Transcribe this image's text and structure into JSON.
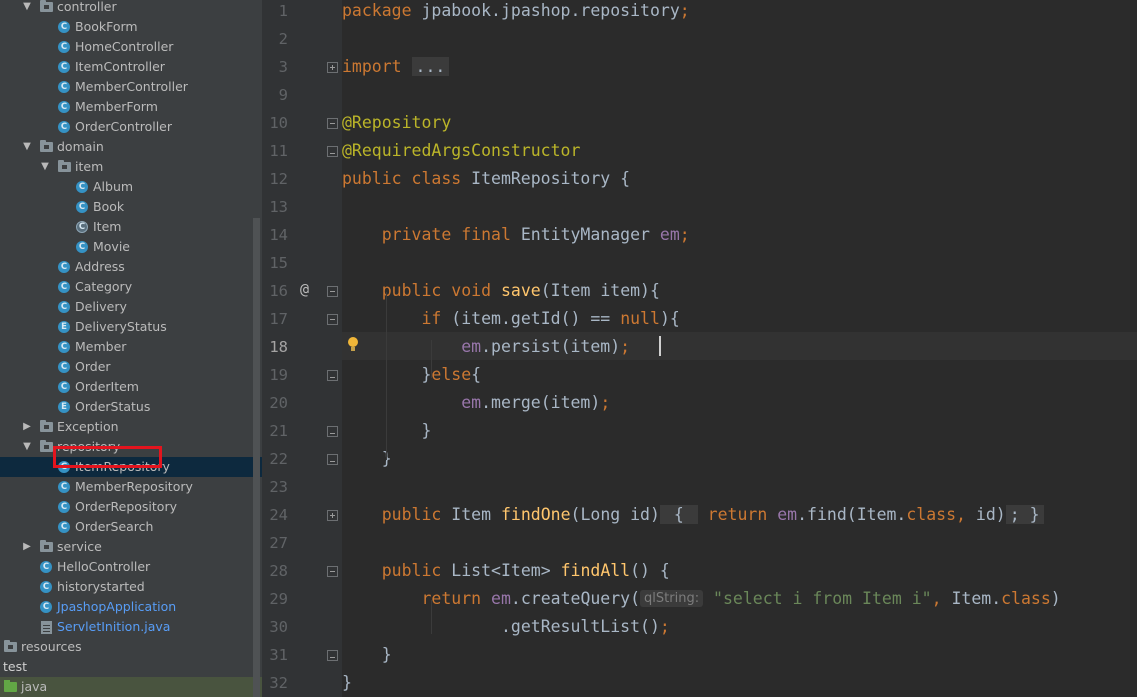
{
  "tree": [
    {
      "label": "controller",
      "kind": "folder",
      "indent": 2,
      "expanded": true
    },
    {
      "label": "BookForm",
      "kind": "class",
      "indent": 3
    },
    {
      "label": "HomeController",
      "kind": "class",
      "indent": 3
    },
    {
      "label": "ItemController",
      "kind": "class",
      "indent": 3
    },
    {
      "label": "MemberController",
      "kind": "class",
      "indent": 3
    },
    {
      "label": "MemberForm",
      "kind": "class",
      "indent": 3
    },
    {
      "label": "OrderController",
      "kind": "class",
      "indent": 3
    },
    {
      "label": "domain",
      "kind": "folder",
      "indent": 2,
      "expanded": true
    },
    {
      "label": "item",
      "kind": "folder",
      "indent": 3,
      "expanded": true
    },
    {
      "label": "Album",
      "kind": "class",
      "indent": 4
    },
    {
      "label": "Book",
      "kind": "class",
      "indent": 4
    },
    {
      "label": "Item",
      "kind": "abstract",
      "indent": 4
    },
    {
      "label": "Movie",
      "kind": "class",
      "indent": 4
    },
    {
      "label": "Address",
      "kind": "class",
      "indent": 3
    },
    {
      "label": "Category",
      "kind": "class",
      "indent": 3
    },
    {
      "label": "Delivery",
      "kind": "class",
      "indent": 3
    },
    {
      "label": "DeliveryStatus",
      "kind": "enum",
      "indent": 3
    },
    {
      "label": "Member",
      "kind": "class",
      "indent": 3
    },
    {
      "label": "Order",
      "kind": "class",
      "indent": 3
    },
    {
      "label": "OrderItem",
      "kind": "class",
      "indent": 3
    },
    {
      "label": "OrderStatus",
      "kind": "enum",
      "indent": 3
    },
    {
      "label": "Exception",
      "kind": "folder",
      "indent": 2,
      "expanded": false
    },
    {
      "label": "repository",
      "kind": "folder",
      "indent": 2,
      "expanded": true
    },
    {
      "label": "ItemRepository",
      "kind": "class",
      "indent": 3,
      "selected": true
    },
    {
      "label": "MemberRepository",
      "kind": "class",
      "indent": 3
    },
    {
      "label": "OrderRepository",
      "kind": "class",
      "indent": 3
    },
    {
      "label": "OrderSearch",
      "kind": "class",
      "indent": 3
    },
    {
      "label": "service",
      "kind": "folder",
      "indent": 2,
      "expanded": false
    },
    {
      "label": "HelloController",
      "kind": "class",
      "indent": 2
    },
    {
      "label": "historystarted",
      "kind": "class",
      "indent": 2
    },
    {
      "label": "JpashopApplication",
      "kind": "class-blue",
      "indent": 2
    },
    {
      "label": "ServletInition.java",
      "kind": "file-blue",
      "indent": 2
    },
    {
      "label": "resources",
      "kind": "folder-plain",
      "indent": 0
    },
    {
      "label": "test",
      "kind": "none",
      "indent": -1
    },
    {
      "label": "java",
      "kind": "greenfolder",
      "indent": 0,
      "green": true
    },
    {
      "label": "resources",
      "kind": "folder-plain",
      "indent": 0
    }
  ],
  "editor": {
    "lines": [
      {
        "n": "1",
        "tokens": [
          [
            "kw",
            "package "
          ],
          [
            "",
            "jpabook.jpashop.repository"
          ],
          [
            "kw",
            ";"
          ]
        ]
      },
      {
        "n": "2",
        "tokens": []
      },
      {
        "n": "3",
        "tokens": [
          [
            "kw",
            "import "
          ],
          [
            "fold",
            "..."
          ]
        ],
        "fold": "plus"
      },
      {
        "n": "9",
        "tokens": []
      },
      {
        "n": "10",
        "tokens": [
          [
            "ann",
            "@Repository"
          ]
        ],
        "fold": "minus"
      },
      {
        "n": "11",
        "tokens": [
          [
            "ann",
            "@RequiredArgsConstructor"
          ]
        ],
        "fold": "end"
      },
      {
        "n": "12",
        "tokens": [
          [
            "kw",
            "public class "
          ],
          [
            "",
            "ItemRepository {"
          ]
        ]
      },
      {
        "n": "13",
        "tokens": []
      },
      {
        "n": "14",
        "tokens": [
          [
            "",
            "    "
          ],
          [
            "kw",
            "private final "
          ],
          [
            "",
            "EntityManager "
          ],
          [
            "fld",
            "em"
          ],
          [
            "kw",
            ";"
          ]
        ]
      },
      {
        "n": "15",
        "tokens": []
      },
      {
        "n": "16",
        "tokens": [
          [
            "",
            "    "
          ],
          [
            "kw",
            "public void "
          ],
          [
            "fn",
            "save"
          ],
          [
            "",
            "(Item item){"
          ]
        ],
        "fold": "minus",
        "at": true
      },
      {
        "n": "17",
        "tokens": [
          [
            "",
            "        "
          ],
          [
            "kw",
            "if "
          ],
          [
            "",
            "(item.getId() == "
          ],
          [
            "kw",
            "null"
          ],
          [
            "",
            "){"
          ]
        ],
        "fold": "minus"
      },
      {
        "n": "18",
        "tokens": [
          [
            "",
            "            "
          ],
          [
            "fld",
            "em"
          ],
          [
            "",
            ".persist(item)"
          ],
          [
            "kw",
            ";"
          ]
        ],
        "current": true
      },
      {
        "n": "19",
        "tokens": [
          [
            "",
            "        }"
          ],
          [
            "kw",
            "else"
          ],
          [
            "",
            "{"
          ]
        ],
        "fold": "end"
      },
      {
        "n": "20",
        "tokens": [
          [
            "",
            "            "
          ],
          [
            "fld",
            "em"
          ],
          [
            "",
            ".merge(item)"
          ],
          [
            "kw",
            ";"
          ]
        ]
      },
      {
        "n": "21",
        "tokens": [
          [
            "",
            "        }"
          ]
        ],
        "fold": "end"
      },
      {
        "n": "22",
        "tokens": [
          [
            "",
            "    }"
          ]
        ],
        "fold": "end"
      },
      {
        "n": "23",
        "tokens": []
      },
      {
        "n": "24",
        "tokens": [
          [
            "",
            "    "
          ],
          [
            "kw",
            "public "
          ],
          [
            "",
            "Item "
          ],
          [
            "fn",
            "findOne"
          ],
          [
            "",
            "(Long id)"
          ],
          [
            "fold",
            " { "
          ],
          [
            "kw",
            " return "
          ],
          [
            "fld",
            "em"
          ],
          [
            "",
            ".find(Item."
          ],
          [
            "kw",
            "class, "
          ],
          [
            "",
            "id)"
          ],
          [
            "fold",
            "; }"
          ]
        ],
        "fold": "plus"
      },
      {
        "n": "27",
        "tokens": []
      },
      {
        "n": "28",
        "tokens": [
          [
            "",
            "    "
          ],
          [
            "kw",
            "public "
          ],
          [
            "",
            "List<Item> "
          ],
          [
            "fn",
            "findAll"
          ],
          [
            "",
            "() {"
          ]
        ],
        "fold": "minus"
      },
      {
        "n": "29",
        "tokens": [
          [
            "",
            "        "
          ],
          [
            "kw",
            "return "
          ],
          [
            "fld",
            "em"
          ],
          [
            "",
            ".createQuery("
          ],
          [
            "hint",
            "qlString:"
          ],
          [
            "str",
            " \"select i from Item i\""
          ],
          [
            "kw",
            ", "
          ],
          [
            "",
            "Item."
          ],
          [
            "kw",
            "class"
          ],
          [
            "",
            ")"
          ]
        ]
      },
      {
        "n": "30",
        "tokens": [
          [
            "",
            "                "
          ],
          [
            "",
            ".getResultList()"
          ],
          [
            "kw",
            ";"
          ]
        ]
      },
      {
        "n": "31",
        "tokens": [
          [
            "",
            "    }"
          ]
        ],
        "fold": "end"
      },
      {
        "n": "32",
        "tokens": [
          [
            "",
            "}"
          ]
        ]
      }
    ]
  },
  "colors": {
    "background": "#2b2b2b",
    "tree_bg": "#3c3f41",
    "keyword": "#cc7832",
    "annotation": "#bbb529",
    "field": "#9876aa",
    "function": "#ffc66d",
    "string": "#6a8759",
    "highlight_box": "#e3141e"
  }
}
